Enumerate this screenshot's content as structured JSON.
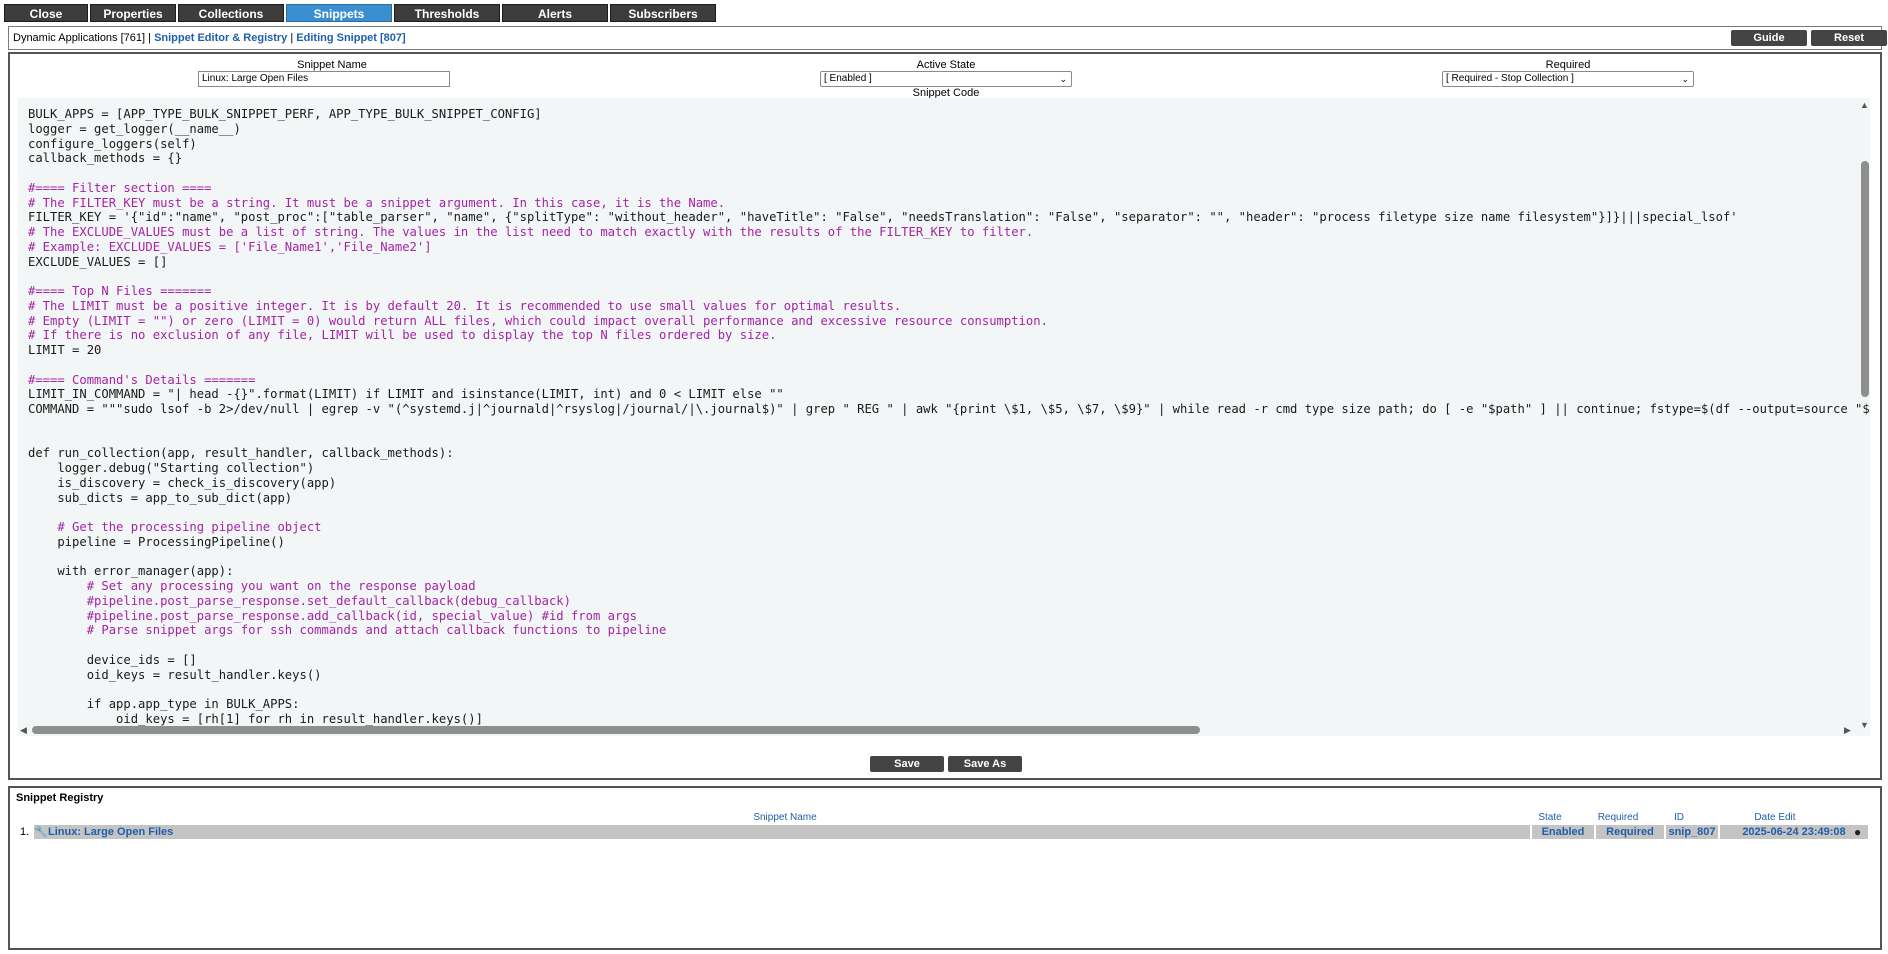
{
  "tabs": [
    {
      "label": "Close",
      "active": false
    },
    {
      "label": "Properties",
      "active": false
    },
    {
      "label": "Collections",
      "active": false
    },
    {
      "label": "Snippets",
      "active": true
    },
    {
      "label": "Thresholds",
      "active": false
    },
    {
      "label": "Alerts",
      "active": false
    },
    {
      "label": "Subscribers",
      "active": false
    }
  ],
  "breadcrumb": {
    "first": "Dynamic Applications [761]",
    "sep1": " | ",
    "second": "Snippet Editor & Registry",
    "sep2": " | ",
    "third": "Editing Snippet [807]"
  },
  "header_buttons": {
    "guide": "Guide",
    "reset": "Reset"
  },
  "form": {
    "snippet_name_label": "Snippet Name",
    "snippet_name_value": "Linux: Large Open Files",
    "active_state_label": "Active State",
    "active_state_value": "[ Enabled ]",
    "required_label": "Required",
    "required_value": "[ Required - Stop Collection ]",
    "snippet_code_label": "Snippet Code"
  },
  "code_lines": [
    "BULK_APPS = [APP_TYPE_BULK_SNIPPET_PERF, APP_TYPE_BULK_SNIPPET_CONFIG]",
    "logger = get_logger(__name__)",
    "configure_loggers(self)",
    "callback_methods = {}",
    "",
    "#==== Filter section ====",
    "# The FILTER_KEY must be a string. It must be a snippet argument. In this case, it is the Name.",
    "FILTER_KEY = '{\"id\":\"name\", \"post_proc\":[\"table_parser\", \"name\", {\"splitType\": \"without_header\", \"haveTitle\": \"False\", \"needsTranslation\": \"False\", \"separator\": \"\", \"header\": \"process filetype size name filesystem\"}]}|||special_lsof'",
    "# The EXCLUDE_VALUES must be a list of string. The values in the list need to match exactly with the results of the FILTER_KEY to filter.",
    "# Example: EXCLUDE_VALUES = ['File_Name1','File_Name2']",
    "EXCLUDE_VALUES = []",
    "",
    "#==== Top N Files =======",
    "# The LIMIT must be a positive integer. It is by default 20. It is recommended to use small values for optimal results.",
    "# Empty (LIMIT = \"\") or zero (LIMIT = 0) would return ALL files, which could impact overall performance and excessive resource consumption.",
    "# If there is no exclusion of any file, LIMIT will be used to display the top N files ordered by size.",
    "LIMIT = 20",
    "",
    "#==== Command's Details =======",
    "LIMIT_IN_COMMAND = \"| head -{}\".format(LIMIT) if LIMIT and isinstance(LIMIT, int) and 0 < LIMIT else \"\"",
    "COMMAND = \"\"\"sudo lsof -b 2>/dev/null | egrep -v \"(^systemd.j|^journald|^rsyslog|/journal/|\\.journal$)\" | grep \" REG \" | awk \"{print \\$1, \\$5, \\$7, \\$9}\" | while read -r cmd type size path; do [ -e \"$path\" ] || continue; fstype=$(df --output=source \"$",
    "",
    "",
    "def run_collection(app, result_handler, callback_methods):",
    "    logger.debug(\"Starting collection\")",
    "    is_discovery = check_is_discovery(app)",
    "    sub_dicts = app_to_sub_dict(app)",
    "",
    "    # Get the processing pipeline object",
    "    pipeline = ProcessingPipeline()",
    "",
    "    with error_manager(app):",
    "        # Set any processing you want on the response payload",
    "        #pipeline.post_parse_response.set_default_callback(debug_callback)",
    "        #pipeline.post_parse_response.add_callback(id, special_value) #id from args",
    "        # Parse snippet args for ssh commands and attach callback functions to pipeline",
    "",
    "        device_ids = []",
    "        oid_keys = result_handler.keys()",
    "",
    "        if app.app_type in BULK_APPS:",
    "            oid_keys = [rh[1] for rh in result_handler.keys()]"
  ],
  "buttons": {
    "save": "Save",
    "save_as": "Save As"
  },
  "registry": {
    "title": "Snippet Registry",
    "columns": {
      "name": "Snippet Name",
      "state": "State",
      "required": "Required",
      "id": "ID",
      "date": "Date Edit"
    },
    "rows": [
      {
        "index": "1.",
        "name": "Linux: Large Open Files",
        "state": "Enabled",
        "required": "Required",
        "id": "snip_807",
        "date": "2025-06-24 23:49:08"
      }
    ]
  },
  "icons": {
    "edit": "wrench-icon",
    "action": "bomb-icon"
  },
  "colors": {
    "tab_bg": "#3c3c3c",
    "tab_active": "#3a8fd1",
    "link": "#1f5fa8",
    "comment": "#a424a4",
    "string": "#2a7d2a",
    "keyword": "#d46a00",
    "code_bg": "#f3f6f7"
  }
}
